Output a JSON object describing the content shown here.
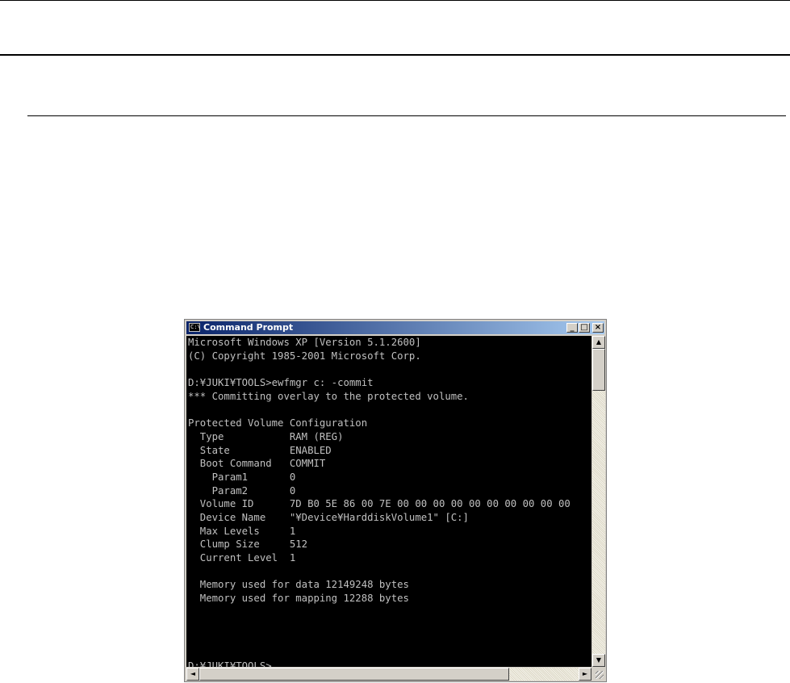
{
  "window": {
    "title": "Command Prompt",
    "icon_label": "C:\\",
    "buttons": {
      "minimize": "_",
      "maximize": "□",
      "close": "×"
    }
  },
  "console": {
    "lines": [
      "Microsoft Windows XP [Version 5.1.2600]",
      "(C) Copyright 1985-2001 Microsoft Corp.",
      "",
      "D:¥JUKI¥TOOLS>ewfmgr c: -commit",
      "*** Committing overlay to the protected volume.",
      "",
      "Protected Volume Configuration",
      "  Type           RAM (REG)",
      "  State          ENABLED",
      "  Boot Command   COMMIT",
      "    Param1       0",
      "    Param2       0",
      "  Volume ID      7D B0 5E 86 00 7E 00 00 00 00 00 00 00 00 00 00",
      "  Device Name    \"¥Device¥HarddiskVolume1\" [C:]",
      "  Max Levels     1",
      "  Clump Size     512",
      "  Current Level  1",
      "",
      "  Memory used for data 12149248 bytes",
      "  Memory used for mapping 12288 bytes",
      "",
      "",
      "",
      "",
      "D:¥JUKI¥TOOLS>"
    ]
  },
  "scrollbars": {
    "up": "▲",
    "down": "▼",
    "left": "◄",
    "right": "►"
  },
  "colors": {
    "console_bg": "#000000",
    "console_fg": "#c0c0c0",
    "title_start": "#0a246a",
    "title_end": "#a6caf0"
  }
}
